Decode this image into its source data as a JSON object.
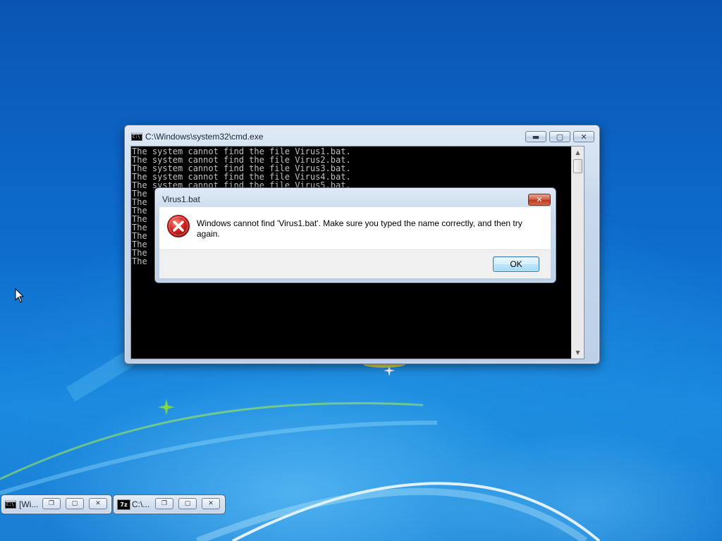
{
  "cmd_window": {
    "title": "C:\\Windows\\system32\\cmd.exe",
    "lines": [
      "The system cannot find the file Virus1.bat.",
      "The system cannot find the file Virus2.bat.",
      "The system cannot find the file Virus3.bat.",
      "The system cannot find the file Virus4.bat.",
      "The system cannot find the file Virus5.bat.",
      "The",
      "The",
      "The",
      "The",
      "The",
      "The",
      "The",
      "The",
      "The"
    ],
    "icon": "console-icon"
  },
  "dialog": {
    "title": "Virus1.bat",
    "message": "Windows cannot find 'Virus1.bat'. Make sure you typed the name correctly, and then try again.",
    "ok_label": "OK",
    "close_label": "✕",
    "icon": "error-icon"
  },
  "taskbar": {
    "items": [
      {
        "label": "[Wi...",
        "icon": "console-icon"
      },
      {
        "label": "C:\\...",
        "icon": "7zip-icon",
        "icon_text": "7z"
      }
    ]
  }
}
